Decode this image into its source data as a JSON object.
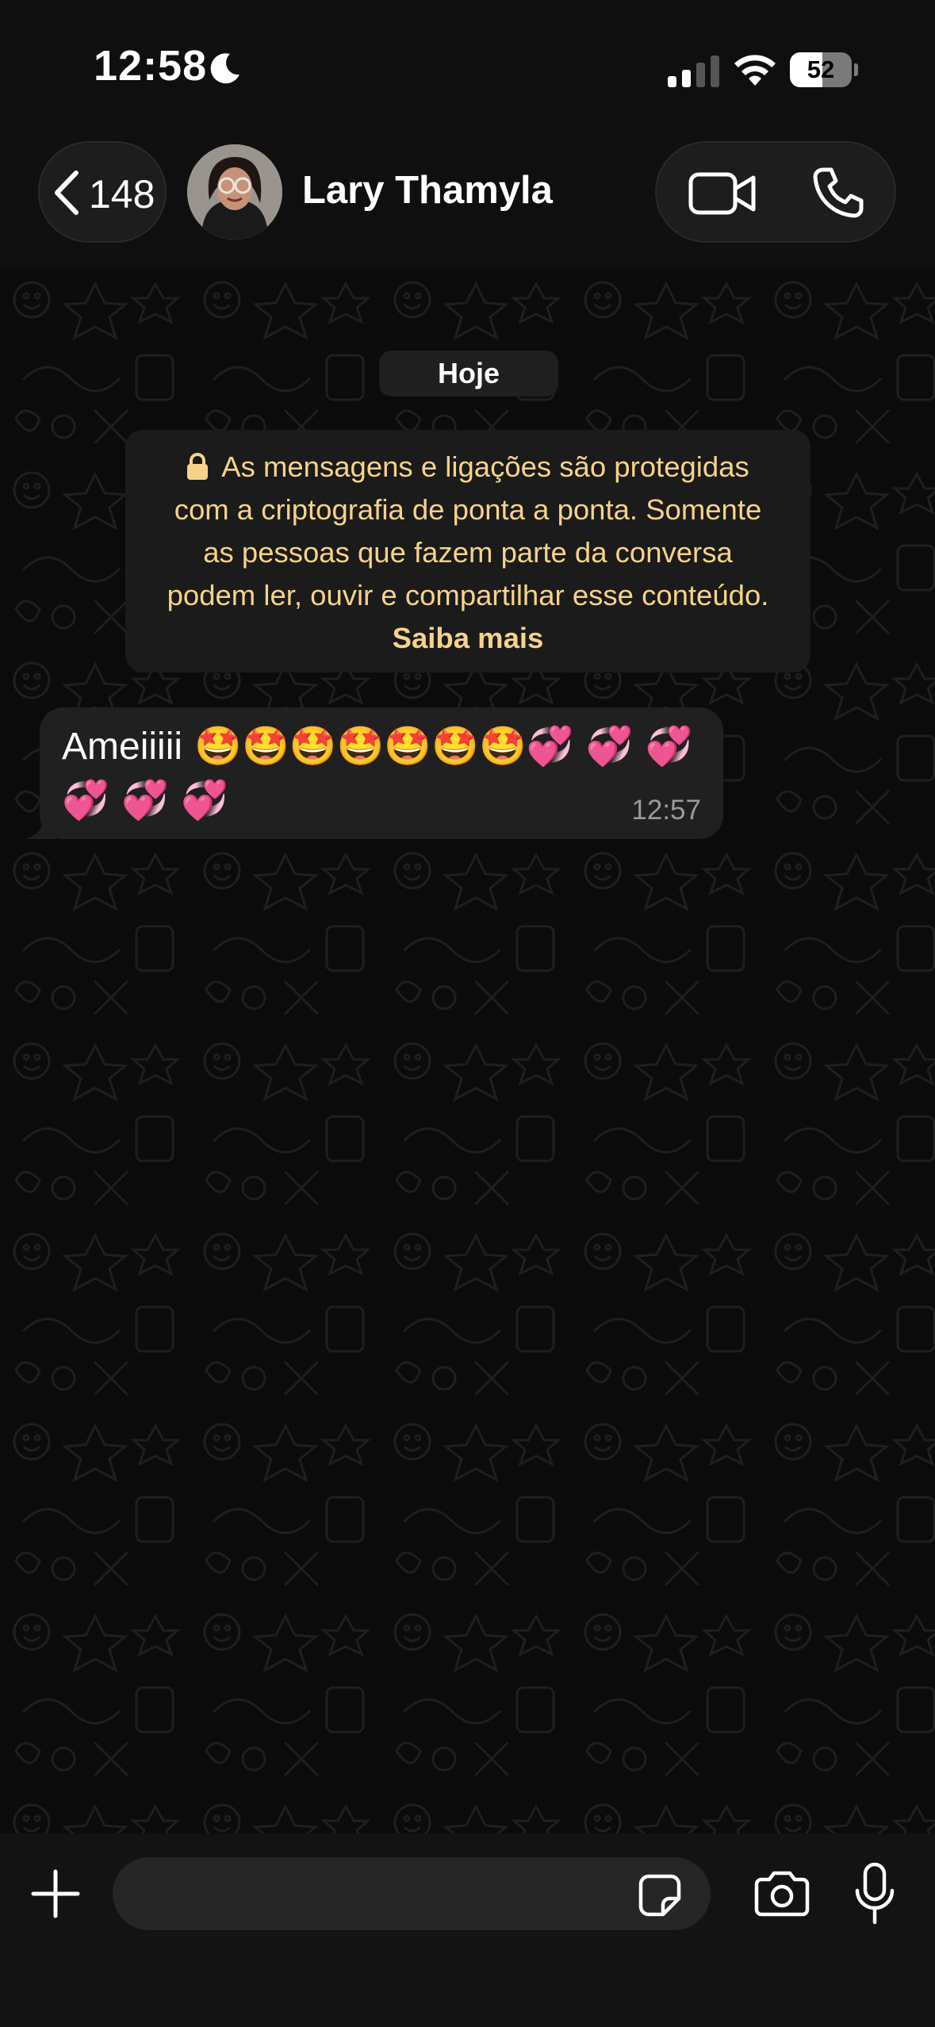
{
  "status_bar": {
    "time": "12:58",
    "battery_level": "52",
    "battery_percent": 52,
    "icons": [
      "moon-icon",
      "cellular-signal-icon",
      "wifi-icon",
      "battery-icon"
    ]
  },
  "header": {
    "back_count": "148",
    "contact_name": "Lary Thamyla",
    "icons": [
      "chevron-left-icon",
      "video-call-icon",
      "phone-call-icon"
    ]
  },
  "chat": {
    "date_label": "Hoje",
    "encryption_notice": "As mensagens e ligações são protegidas com a criptografia de ponta a ponta. Somente as pessoas que fazem parte da conversa podem ler, ouvir e compartilhar esse conteúdo.",
    "encryption_link": "Saiba mais",
    "messages": [
      {
        "text": "Ameiiiii 🤩🤩🤩🤩🤩🤩🤩💞 💞 💞 💞 💞 💞",
        "time": "12:57"
      }
    ]
  },
  "composer": {
    "input_value": "",
    "icons": [
      "plus-icon",
      "sticker-icon",
      "camera-icon",
      "microphone-icon"
    ]
  },
  "colors": {
    "notice_text": "#f6d38a",
    "bubble_background": "#202020",
    "background": "#0b0b0b"
  }
}
